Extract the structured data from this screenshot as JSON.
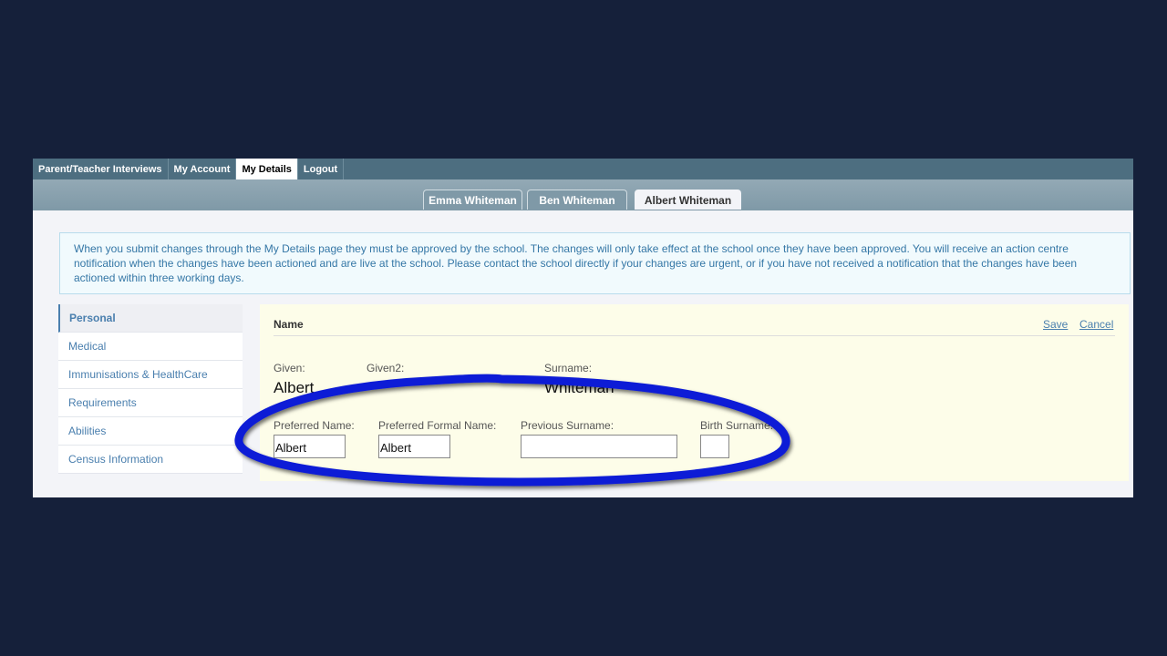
{
  "topnav": {
    "items": [
      "Parent/Teacher Interviews",
      "My Account",
      "My Details",
      "Logout"
    ]
  },
  "student_tabs": [
    "Emma Whiteman",
    "Ben Whiteman",
    "Albert Whiteman"
  ],
  "notice": {
    "text": "When you submit changes through the My Details page they must be approved by the school. The changes will only take effect at the school once they have been approved. You will receive an action centre notification when the changes have been actioned and are live at the school. Please contact the school directly if your changes are urgent, or if you have not received a notification that the changes have been actioned within three working days."
  },
  "sidebar": {
    "items": [
      "Personal",
      "Medical",
      "Immunisations & HealthCare",
      "Requirements",
      "Abilities",
      "Census Information"
    ]
  },
  "panel": {
    "title": "Name",
    "save": "Save",
    "cancel": "Cancel",
    "given_label": "Given:",
    "given_value": "Albert",
    "given2_label": "Given2:",
    "surname_label": "Surname:",
    "surname_value": "Whiteman",
    "preferred_name_label": "Preferred Name:",
    "preferred_name_value": "Albert",
    "preferred_formal_label": "Preferred Formal Name:",
    "preferred_formal_value": "Albert",
    "previous_surname_label": "Previous Surname:",
    "previous_surname_value": "",
    "birth_surname_label": "Birth Surname:",
    "birth_surname_value": ""
  },
  "colors": {
    "background": "#15203a",
    "nav": "#4d6e80",
    "annotation": "#0a1ad6"
  }
}
